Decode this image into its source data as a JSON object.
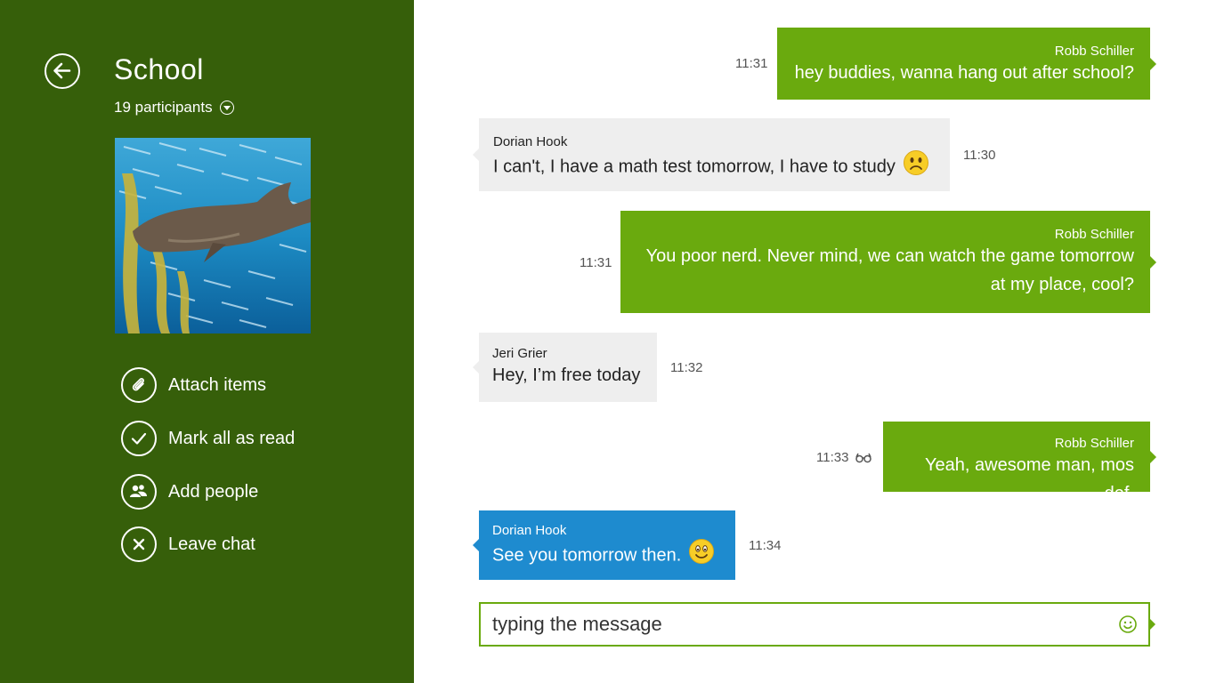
{
  "conversation": {
    "title": "School",
    "participants": "19 participants"
  },
  "actions": [
    {
      "label": "Attach items",
      "icon": "paperclip-icon"
    },
    {
      "label": "Mark all as read",
      "icon": "checkmark-icon"
    },
    {
      "label": "Add people",
      "icon": "people-icon"
    },
    {
      "label": "Leave chat",
      "icon": "close-icon"
    }
  ],
  "messages": [
    {
      "sender": "Robb Schiller",
      "text": "hey buddies, wanna hang out after school?",
      "time": "11:31",
      "direction": "outgoing"
    },
    {
      "sender": "Dorian Hook",
      "text": "I can't, I have a math test tomorrow, I have to study",
      "time": "11:30",
      "direction": "incoming",
      "emoji": "sad-face-icon"
    },
    {
      "sender": "Robb Schiller",
      "text_line1": "You poor nerd. Never mind, we can watch the game tomorrow",
      "text_line2": "at my place, cool?",
      "time": "11:31",
      "direction": "outgoing"
    },
    {
      "sender": "Jeri Grier",
      "text": "Hey, I’m free today",
      "time": "11:32",
      "direction": "incoming"
    },
    {
      "sender": "Robb Schiller",
      "text": "Yeah, awesome man, mos def.",
      "time": "11:33",
      "direction": "outgoing",
      "status_icon": "seen-glasses-icon"
    },
    {
      "sender": "Dorian Hook",
      "text": "See you tomorrow then.",
      "time": "11:34",
      "direction": "incoming",
      "emoji": "smile-face-icon"
    }
  ],
  "composer": {
    "value": "typing the message"
  },
  "colors": {
    "sidebar": "#365f0a",
    "outgoing": "#6aaa0e",
    "incoming": "#eeeeee",
    "incoming_selected": "#1e8bcf"
  }
}
